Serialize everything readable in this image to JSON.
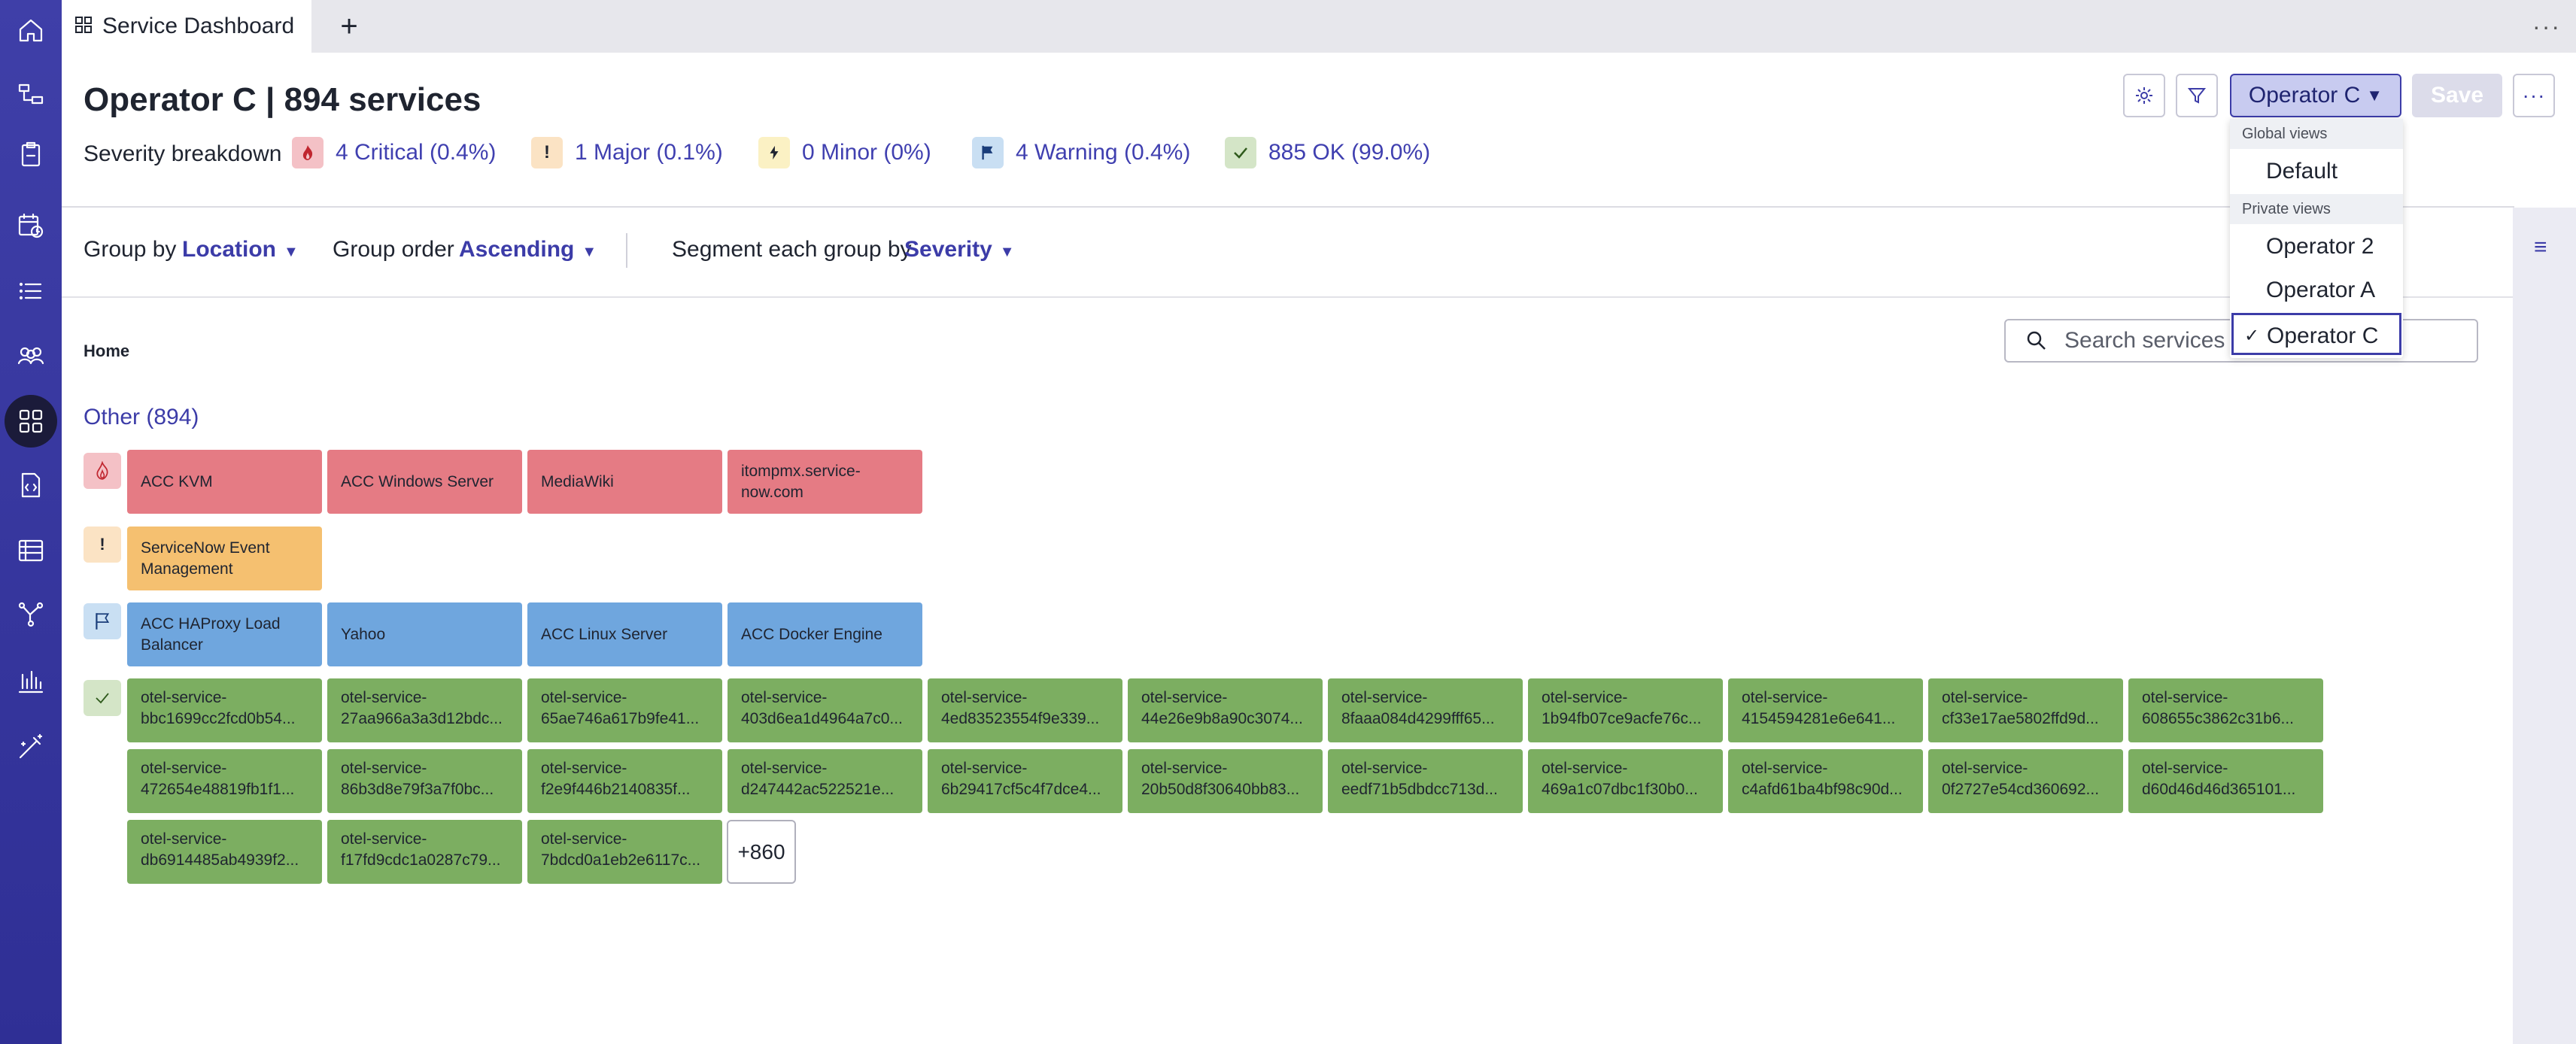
{
  "tab": {
    "title": "Service Dashboard",
    "add_label": "+",
    "more_label": "···"
  },
  "header": {
    "title": "Operator C | 894 services",
    "severity_label": "Severity breakdown",
    "severities": [
      {
        "label": "4 Critical (0.4%)",
        "icon": "flame-icon",
        "color": "#f4c1c6"
      },
      {
        "label": "1 Major (0.1%)",
        "icon": "exclamation-icon",
        "color": "#fbe3c4"
      },
      {
        "label": "0 Minor (0%)",
        "icon": "bolt-icon",
        "color": "#fbf1c4"
      },
      {
        "label": "4 Warning (0.4%)",
        "icon": "flag-icon",
        "color": "#c9dff3"
      },
      {
        "label": "885 OK (99.0%)",
        "icon": "check-icon",
        "color": "#d4e5c7"
      }
    ]
  },
  "actions": {
    "view_selected": "Operator C",
    "save_label": "Save",
    "more_label": "···"
  },
  "toolbar": {
    "group_by_label": "Group by",
    "group_by_value": "Location",
    "group_order_label": "Group order",
    "group_order_value": "Ascending",
    "segment_label": "Segment each group by",
    "segment_value": "Severity"
  },
  "breadcrumb": {
    "home": "Home"
  },
  "search": {
    "placeholder": "Search services"
  },
  "group": {
    "heading": "Other (894)"
  },
  "tiles": {
    "critical": [
      "ACC KVM",
      "ACC Windows Server",
      "MediaWiki",
      "itompmx.service-now.com"
    ],
    "major": [
      "ServiceNow Event Management"
    ],
    "warning": [
      "ACC HAProxy Load Balancer",
      "Yahoo",
      "ACC Linux Server",
      "ACC Docker Engine"
    ],
    "ok": [
      "bbc1699cc2fcd0b54...",
      "27aa966a3a3d12bdc...",
      "65ae746a617b9fe41...",
      "403d6ea1d4964a7c0...",
      "4ed83523554f9e339...",
      "44e26e9b8a90c3074...",
      "8faaa084d4299fff65...",
      "1b94fb07ce9acfe76c...",
      "4154594281e6e641...",
      "cf33e17ae5802ffd9d...",
      "608655c3862c31b6...",
      "472654e48819fb1f1...",
      "86b3d8e79f3a7f0bc...",
      "f2e9f446b2140835f...",
      "d247442ac522521e...",
      "6b29417cf5c4f7dce4...",
      "20b50d8f30640bb83...",
      "eedf71b5dbdcc713d...",
      "469a1c07dbc1f30b0...",
      "c4afd61ba4bf98c90d...",
      "0f2727e54cd360692...",
      "d60d46d46d365101...",
      "db6914485ab4939f2...",
      "f17fd9cdc1a0287c79...",
      "7bdcd0a1eb2e6117c..."
    ],
    "ok_prefix": "otel-service-",
    "more_label": "+860"
  },
  "dropdown": {
    "global_label": "Global views",
    "global_items": [
      "Default"
    ],
    "private_label": "Private views",
    "private_items": [
      "Operator 2",
      "Operator A",
      "Operator C"
    ],
    "selected": "Operator C",
    "check_glyph": "✓"
  },
  "colors": {
    "sidebar": "#3f3fa8",
    "accent": "#3c3ca8",
    "critical": "#e57b84",
    "major": "#f5c070",
    "warning": "#6fa6de",
    "ok": "#7cae61"
  }
}
